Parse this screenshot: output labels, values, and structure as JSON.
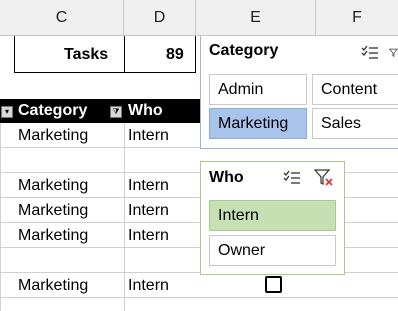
{
  "columns": [
    "C",
    "D",
    "E",
    "F"
  ],
  "summary": {
    "label": "Tasks",
    "value": "89"
  },
  "table": {
    "headers": [
      "Category",
      "Who"
    ],
    "rows": [
      {
        "category": "Marketing",
        "who": "Intern"
      },
      {
        "category": "Marketing",
        "who": "Intern"
      },
      {
        "category": "Marketing",
        "who": "Intern"
      },
      {
        "category": "Marketing",
        "who": "Intern"
      },
      {
        "category": "Marketing",
        "who": "Intern"
      }
    ]
  },
  "slicers": {
    "category": {
      "title": "Category",
      "items": [
        "Admin",
        "Content",
        "Marketing",
        "Sales"
      ],
      "selected": "Marketing",
      "icons": [
        "multi-select-icon",
        "clear-filter-icon"
      ]
    },
    "who": {
      "title": "Who",
      "items": [
        "Intern",
        "Owner"
      ],
      "selected": "Intern",
      "icons": [
        "multi-select-icon",
        "clear-filter-icon"
      ]
    }
  },
  "colors": {
    "selected_blue": "#a9c4ec",
    "selected_green": "#c6e0b4",
    "header_black": "#000000"
  }
}
